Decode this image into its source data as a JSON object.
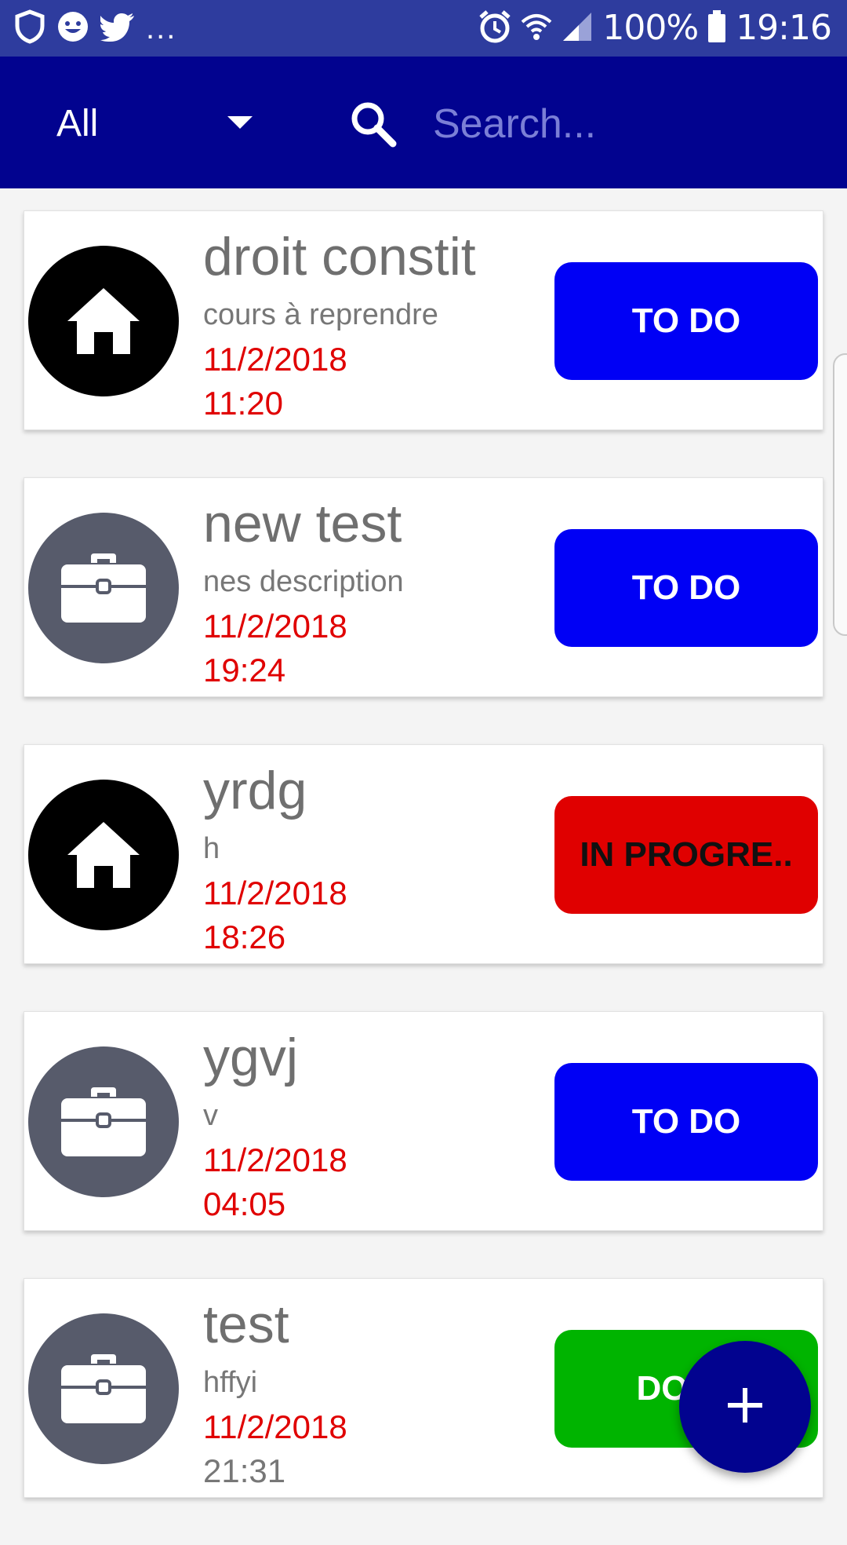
{
  "status_bar": {
    "left_icons": [
      "shield-icon",
      "face-icon",
      "twitter-icon"
    ],
    "overflow": "...",
    "battery": "100%",
    "time": "19:16"
  },
  "app_bar": {
    "filter_value": "All",
    "search_placeholder": "Search..."
  },
  "tasks": [
    {
      "title": "droit constit",
      "description": "cours à reprendre",
      "date": "11/2/2018",
      "time": "11:20",
      "category_icon": "home-icon",
      "status": "TO DO",
      "status_color": "#0000f5"
    },
    {
      "title": "new test",
      "description": "nes description",
      "date": "11/2/2018",
      "time": "19:24",
      "category_icon": "briefcase-icon",
      "status": "TO DO",
      "status_color": "#0000f5"
    },
    {
      "title": "yrdg",
      "description": "h",
      "date": "11/2/2018",
      "time": "18:26",
      "category_icon": "home-icon",
      "status": "IN PROGRE..",
      "status_color": "#e00000"
    },
    {
      "title": "ygvj",
      "description": "v",
      "date": "11/2/2018",
      "time": "04:05",
      "category_icon": "briefcase-icon",
      "status": "TO DO",
      "status_color": "#0000f5"
    },
    {
      "title": "test",
      "description": "hffyi",
      "date": "11/2/2018",
      "time": "21:31",
      "category_icon": "briefcase-icon",
      "status": "DONE",
      "status_color": "#00b400"
    }
  ],
  "fab": {
    "icon": "plus-icon"
  },
  "colors": {
    "status_bar": "#2e3c9e",
    "app_bar": "#02038f",
    "date_red": "#e00000",
    "todo_blue": "#0000f5",
    "progress_red": "#e00000",
    "done_green": "#00b400"
  }
}
